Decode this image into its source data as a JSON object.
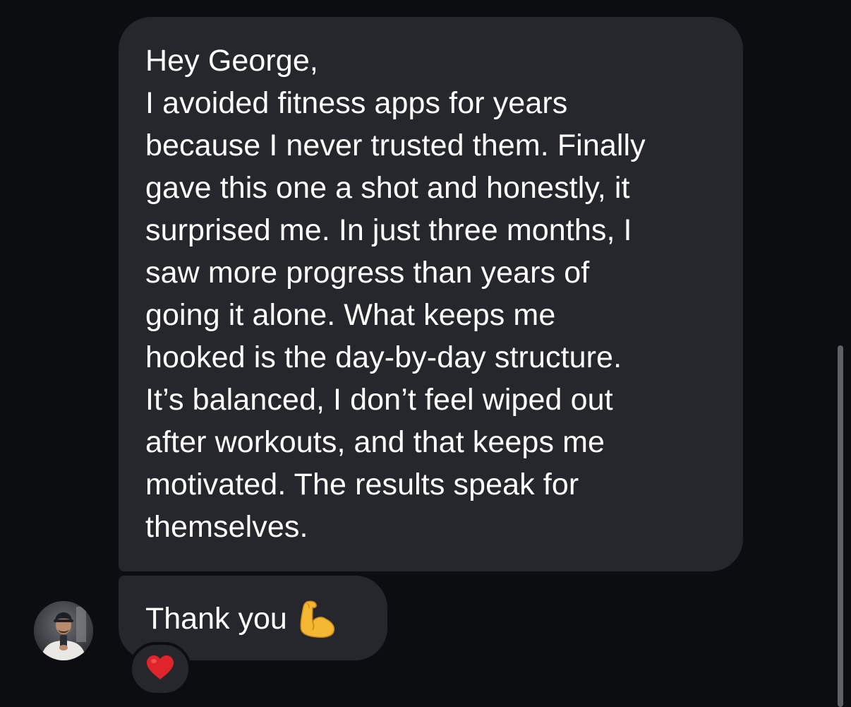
{
  "chat": {
    "incoming_message": {
      "lines": [
        "Hey George,",
        "I avoided fitness apps for years",
        "because I never trusted them. Finally",
        "gave this one a shot and honestly, it",
        "surprised me. In just three months, I",
        "saw more progress than years of",
        "going it alone. What keeps me",
        "hooked is the day-by-day structure.",
        "It’s balanced, I don’t feel wiped out",
        "after workouts, and that keeps me",
        "motivated. The results speak for",
        "themselves."
      ]
    },
    "thanks_message": {
      "text": "Thank you",
      "emoji_icon": "flexed-biceps-icon"
    },
    "reaction": {
      "icon": "red-heart-icon"
    },
    "avatar": {
      "icon": "user-avatar-photo"
    }
  },
  "colors": {
    "background": "#0b0d11",
    "bubble": "#25272c",
    "text": "#ffffff",
    "heart": "#e0242c",
    "biceps": "#f4b833"
  }
}
